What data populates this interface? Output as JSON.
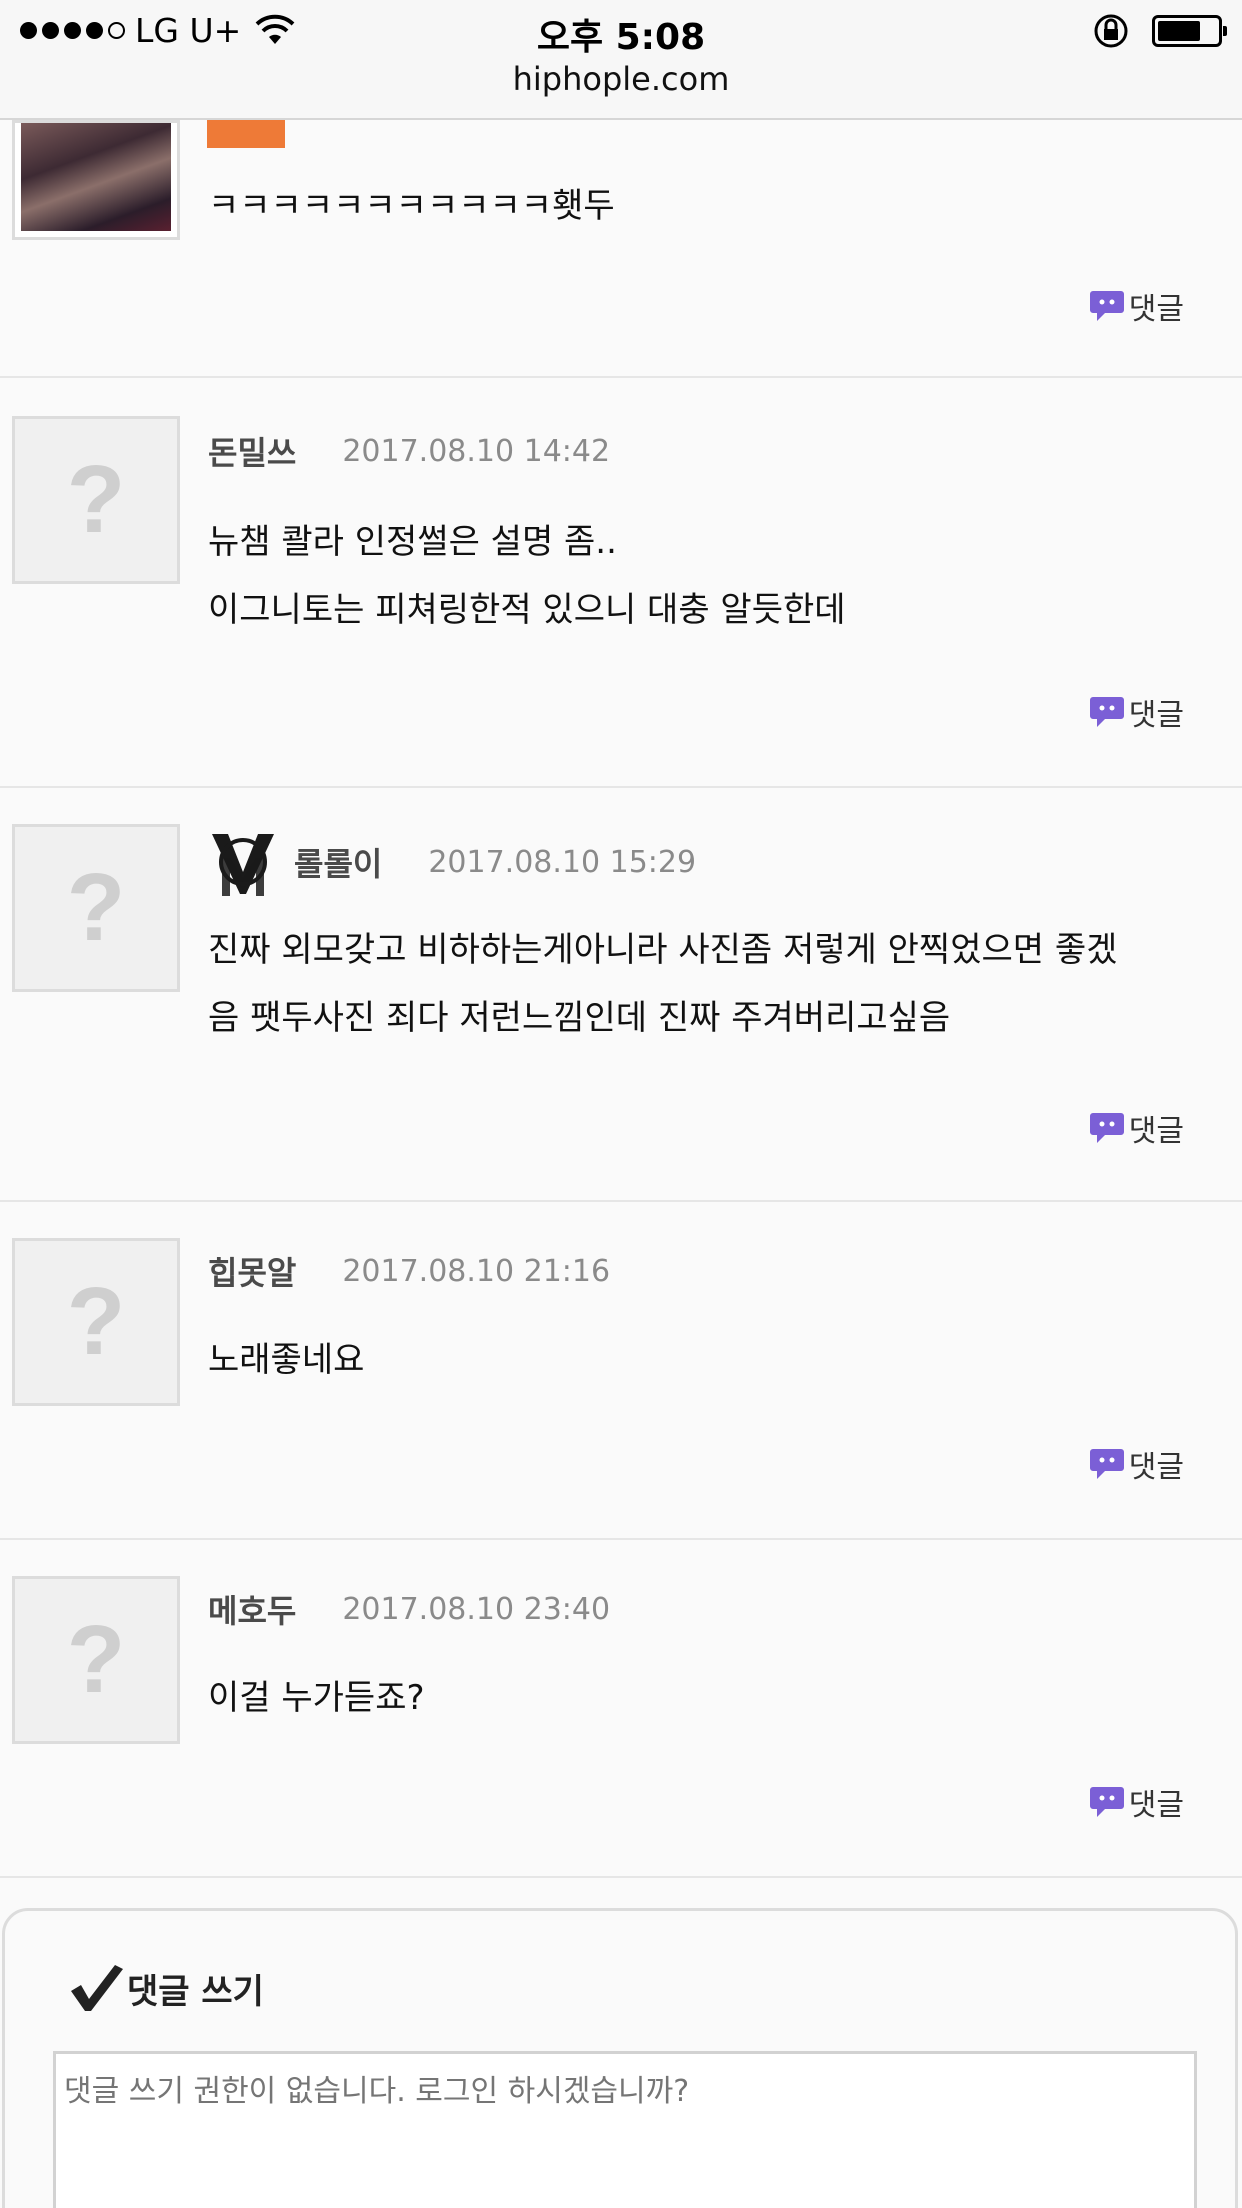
{
  "status_bar": {
    "carrier": "LG U+",
    "time": "오후 5:08",
    "url": "hiphople.com"
  },
  "first_comment": {
    "text": "ㅋㅋㅋㅋㅋㅋㅋㅋㅋㅋㅋ횃두",
    "reply_label": "댓글"
  },
  "comments": [
    {
      "author": "돈밀쓰",
      "date": "2017.08.10 14:42",
      "lines": [
        "뉴챔 콸라 인정썰은 설명 좀..",
        "이그니토는 피쳐링한적 있으니 대충 알듯한데"
      ],
      "reply_label": "댓글"
    },
    {
      "author": "롤롤이",
      "date": "2017.08.10 15:29",
      "lines": [
        "진짜 외모갖고 비하하는게아니라 사진좀 저렇게 안찍었으면 좋겠",
        "음 팻두사진 죄다 저런느낌인데 진짜 주겨버리고싶음"
      ],
      "reply_label": "댓글"
    },
    {
      "author": "힙못알",
      "date": "2017.08.10 21:16",
      "lines": [
        "노래좋네요"
      ],
      "reply_label": "댓글"
    },
    {
      "author": "메호두",
      "date": "2017.08.10 23:40",
      "lines": [
        "이걸 누가듣죠?"
      ],
      "reply_label": "댓글"
    }
  ],
  "write": {
    "title": "댓글 쓰기",
    "placeholder": "댓글 쓰기 권한이 없습니다. 로그인 하시겠습니까?"
  },
  "colors": {
    "accent_orange": "#ee7a37",
    "reply_icon_purple": "#7b5fd6"
  }
}
